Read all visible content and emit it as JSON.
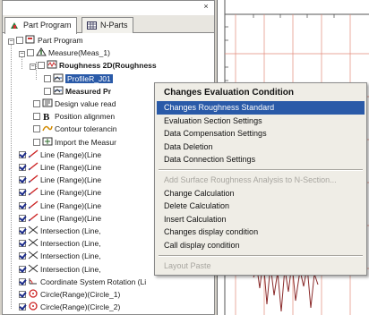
{
  "tabs": [
    {
      "label": "Part Program",
      "icon": "part-program-icon"
    },
    {
      "label": "N-Parts",
      "icon": "grid-icon"
    }
  ],
  "panel_close": "×",
  "tree": [
    {
      "label": "Part Program",
      "icon": "part-icon",
      "expand": "−",
      "bold": false
    },
    {
      "label": "Measure(Meas_1)",
      "icon": "measure-icon",
      "expand": "−",
      "bold": false
    },
    {
      "label": "Roughness 2D(Roughness",
      "icon": "roughness-icon",
      "expand": "−",
      "bold": true
    },
    {
      "label": "ProfileR_J01",
      "icon": "profile-icon",
      "selected": true
    },
    {
      "label": "Measured Pr",
      "icon": "profile-icon",
      "bold": true
    },
    {
      "label": "Design value read",
      "icon": "design-icon"
    },
    {
      "label": "Position alignmen",
      "icon": "b-icon"
    },
    {
      "label": "Contour tolerancin",
      "icon": "contour-icon"
    },
    {
      "label": "Import the Measur",
      "icon": "import-icon"
    },
    {
      "label": "Line (Range)(Line",
      "icon": "line-icon",
      "checked": true
    },
    {
      "label": "Line (Range)(Line",
      "icon": "line-icon",
      "checked": true
    },
    {
      "label": "Line (Range)(Line",
      "icon": "line-icon",
      "checked": true
    },
    {
      "label": "Line (Range)(Line",
      "icon": "line-icon",
      "checked": true
    },
    {
      "label": "Line (Range)(Line",
      "icon": "line-icon",
      "checked": true
    },
    {
      "label": "Line (Range)(Line",
      "icon": "line-icon",
      "checked": true
    },
    {
      "label": "Intersection (Line,",
      "icon": "intersection-icon",
      "checked": true
    },
    {
      "label": "Intersection (Line,",
      "icon": "intersection-icon",
      "checked": true
    },
    {
      "label": "Intersection (Line,",
      "icon": "intersection-icon",
      "checked": true
    },
    {
      "label": "Intersection (Line,",
      "icon": "intersection-icon",
      "checked": true
    },
    {
      "label": "Coordinate System Rotation (Li",
      "icon": "rotation-icon",
      "checked": true
    },
    {
      "label": "Circle(Range)(Circle_1)",
      "icon": "circle-icon",
      "checked": true
    },
    {
      "label": "Circle(Range)(Circle_2)",
      "icon": "circle-icon",
      "checked": true
    }
  ],
  "menu": {
    "items": [
      {
        "label": "Changes Evaluation Condition",
        "type": "header"
      },
      {
        "label": "Changes Roughness Standard",
        "type": "highlighted"
      },
      {
        "label": "Evaluation Section Settings",
        "type": "normal"
      },
      {
        "label": "Data Compensation Settings",
        "type": "normal"
      },
      {
        "label": "Data Deletion",
        "type": "normal"
      },
      {
        "label": "Data Connection Settings",
        "type": "normal"
      },
      {
        "type": "separator"
      },
      {
        "label": "Add Surface Roughness Analysis to N-Section...",
        "type": "disabled"
      },
      {
        "label": "Change Calculation",
        "type": "normal"
      },
      {
        "label": "Delete Calculation",
        "type": "normal"
      },
      {
        "label": "Insert Calculation",
        "type": "normal"
      },
      {
        "label": "Changes display condition",
        "type": "normal"
      },
      {
        "label": "Call display condition",
        "type": "normal"
      },
      {
        "type": "separator"
      },
      {
        "label": "Layout Paste",
        "type": "disabled"
      }
    ]
  },
  "colors": {
    "accent": "#2a5aa8",
    "graph_grid": "#e28a7a",
    "profile": "#8a2a2a"
  }
}
